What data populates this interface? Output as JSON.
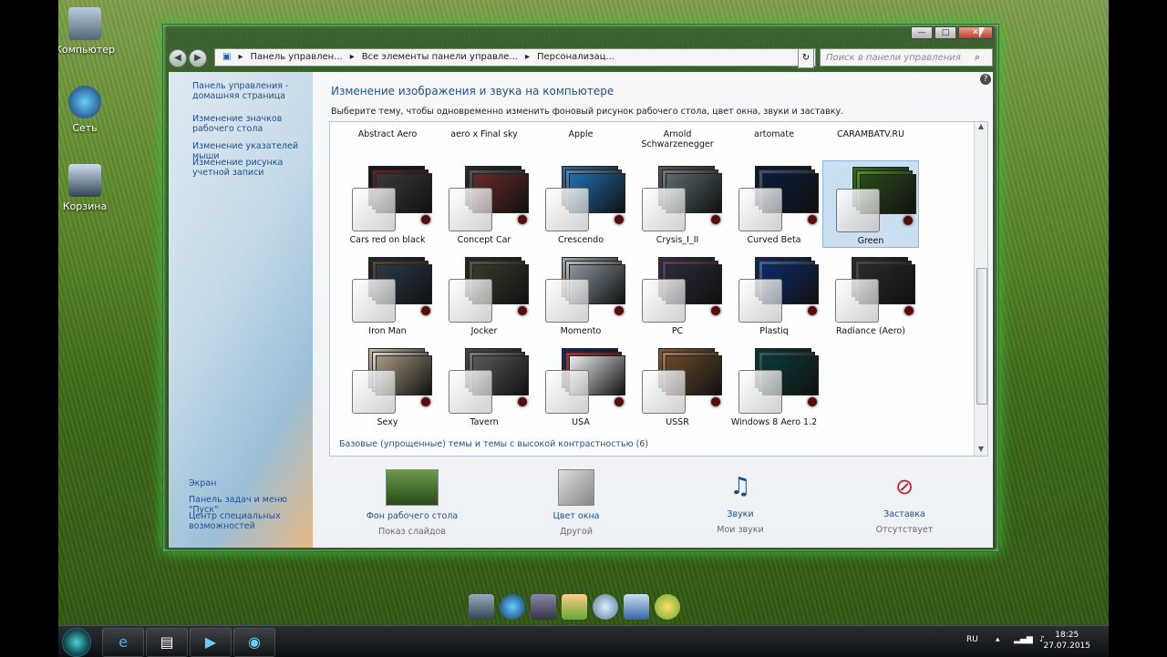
{
  "desktop": {
    "icons": [
      {
        "label": "Компьютер",
        "icon": "computer-icon"
      },
      {
        "label": "Сеть",
        "icon": "network-icon"
      },
      {
        "label": "Корзина",
        "icon": "recycle-bin-icon"
      }
    ]
  },
  "window": {
    "controls": {
      "minimize": "—",
      "maximize": "□",
      "close": "✕"
    },
    "breadcrumb": [
      "Панель управлен...",
      "Все элементы панели управле...",
      "Персонализац..."
    ],
    "search_placeholder": "Поиск в панели управления",
    "sidebar": {
      "home_link": "Панель управления - домашняя страница",
      "links": [
        "Изменение значков рабочего стола",
        "Изменение указателей мыши",
        "Изменение рисунка учетной записи"
      ],
      "see_also_links": [
        "Экран",
        "Панель задач и меню \"Пуск\"",
        "Центр специальных возможностей"
      ]
    },
    "heading": "Изменение изображения и звука на компьютере",
    "subheading": "Выберите тему, чтобы одновременно изменить фоновый рисунок рабочего стола, цвет окна, звуки и заставку.",
    "themes_partial_row": [
      "Abstract Aero",
      "aero x Final sky",
      "Apple",
      "Arnold Schwarzenegger",
      "artomate",
      "CARAMBATV.RU"
    ],
    "themes": [
      {
        "name": "Cars red on black",
        "colors": [
          "#1a1a1a",
          "#7a1a1a",
          "#3a3a3a"
        ]
      },
      {
        "name": "Concept Car",
        "colors": [
          "#2a2a2a",
          "#555",
          "#6a2a2a"
        ]
      },
      {
        "name": "Crescendo",
        "colors": [
          "#1f6fb0",
          "#3a8fd0",
          "#1f6fb0"
        ]
      },
      {
        "name": "Crysis_I_II",
        "colors": [
          "#556",
          "#778",
          "#5a6a6a"
        ]
      },
      {
        "name": "Curved Beta",
        "colors": [
          "#0a1a3a",
          "#2a5a9a",
          "#0a1a3a"
        ]
      },
      {
        "name": "Green",
        "colors": [
          "#3a6a2a",
          "#5a8a3a",
          "#2a4a1a"
        ],
        "selected": true
      },
      {
        "name": "Iron Man",
        "colors": [
          "#1a2a3a",
          "#5a4a2a",
          "#2a3a4a"
        ]
      },
      {
        "name": "Jocker",
        "colors": [
          "#2a2a1a",
          "#5a5a4a",
          "#3a3a2a"
        ]
      },
      {
        "name": "Momento",
        "colors": [
          "#9aa6b0",
          "#b8c2c8",
          "#8a96a0"
        ]
      },
      {
        "name": "PC",
        "colors": [
          "#3a2a4a",
          "#6a3a6a",
          "#2a2a3a"
        ]
      },
      {
        "name": "Plastiq",
        "colors": [
          "#0a2a6a",
          "#2a6acf",
          "#0a2a6a"
        ]
      },
      {
        "name": "Radiance (Aero)",
        "colors": [
          "#2a2a2a",
          "#4a4a4a",
          "#2a2a2a"
        ]
      },
      {
        "name": "Sexy",
        "colors": [
          "#c8b8a0",
          "#e8d8c8",
          "#a89880"
        ]
      },
      {
        "name": "Tavern",
        "colors": [
          "#4a4a4a",
          "#7a7a7a",
          "#5a5a5a"
        ]
      },
      {
        "name": "USA",
        "colors": [
          "#1a2a6a",
          "#c02a2a",
          "#eeeeee"
        ]
      },
      {
        "name": "USSR",
        "colors": [
          "#8a5a2a",
          "#c07a2a",
          "#6a4a2a"
        ]
      },
      {
        "name": "Windows 8 Aero 1.2",
        "colors": [
          "#0a3a3a",
          "#1a6a6a",
          "#0a3a3a"
        ]
      }
    ],
    "basic_link": "Базовые (упрощенные) темы и темы с высокой контрастностью (6)",
    "bottom": [
      {
        "link": "Фон рабочего стола",
        "value": "Показ слайдов",
        "icon": "desktop-background-icon"
      },
      {
        "link": "Цвет окна",
        "value": "Другой",
        "icon": "window-color-icon"
      },
      {
        "link": "Звуки",
        "value": "Мои звуки",
        "icon": "sounds-icon"
      },
      {
        "link": "Заставка",
        "value": "Отсутствует",
        "icon": "screensaver-icon"
      }
    ]
  },
  "taskbar": {
    "language": "RU",
    "time": "18:25",
    "date": "27.07.2015"
  }
}
